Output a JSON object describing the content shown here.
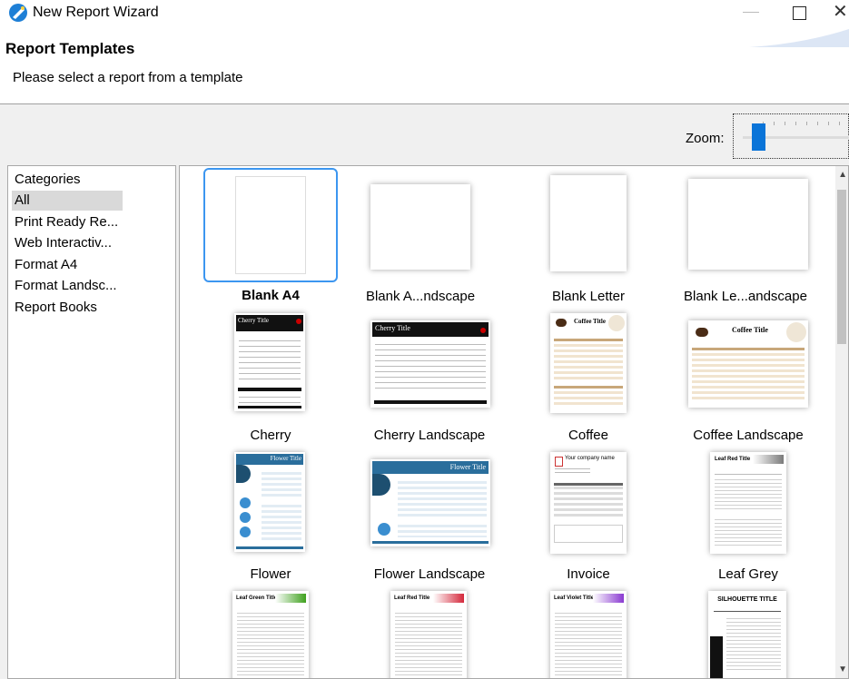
{
  "window": {
    "title": "New Report Wizard",
    "icon": "wizard-app-icon"
  },
  "header": {
    "title": "Report Templates",
    "subtitle": "Please select a report from a template"
  },
  "zoom": {
    "label": "Zoom:",
    "level": 0.12
  },
  "categories": {
    "header": "Categories",
    "items": [
      "All",
      "Print Ready Re...",
      "Web Interactiv...",
      "Format A4",
      "Format Landsc...",
      "Report Books"
    ],
    "selected": "All"
  },
  "templates": [
    {
      "label": "Blank A4",
      "style": "blank",
      "selected": true
    },
    {
      "label": "Blank A...ndscape",
      "style": "blank"
    },
    {
      "label": "Blank Letter",
      "style": "blank"
    },
    {
      "label": "Blank Le...andscape",
      "style": "blank"
    },
    {
      "label": "Cherry",
      "style": "cherry",
      "thumb_title": "Cherry Title"
    },
    {
      "label": "Cherry Landscape",
      "style": "cherry",
      "thumb_title": "Cherry Title"
    },
    {
      "label": "Coffee",
      "style": "coffee",
      "thumb_title": "Coffee Title"
    },
    {
      "label": "Coffee Landscape",
      "style": "coffee",
      "thumb_title": "Coffee Title"
    },
    {
      "label": "Flower",
      "style": "flower",
      "thumb_title": "Flower Title"
    },
    {
      "label": "Flower Landscape",
      "style": "flower",
      "thumb_title": "Flower Title"
    },
    {
      "label": "Invoice",
      "style": "invoice",
      "thumb_title": "Your company name"
    },
    {
      "label": "Leaf Grey",
      "style": "leaf",
      "thumb_title": "Leaf Red Title"
    },
    {
      "label": "",
      "style": "leaf-green",
      "thumb_title": "Leaf Green Title"
    },
    {
      "label": "",
      "style": "leaf-red",
      "thumb_title": "Leaf Red Title"
    },
    {
      "label": "",
      "style": "leaf-violet",
      "thumb_title": "Leaf Violet Title"
    },
    {
      "label": "",
      "style": "silhouette",
      "thumb_title": "SILHOUETTE TITLE"
    }
  ],
  "colors": {
    "accent": "#0a74d8",
    "selection_border": "#3c96f0",
    "cherry": "#111111",
    "coffee": "#c8a77a",
    "flower": "#2a6e9c"
  }
}
